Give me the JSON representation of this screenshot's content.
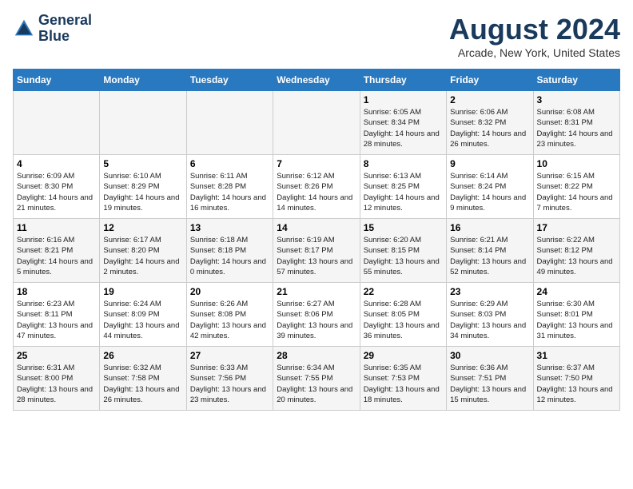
{
  "logo": {
    "line1": "General",
    "line2": "Blue"
  },
  "title": "August 2024",
  "subtitle": "Arcade, New York, United States",
  "days_of_week": [
    "Sunday",
    "Monday",
    "Tuesday",
    "Wednesday",
    "Thursday",
    "Friday",
    "Saturday"
  ],
  "weeks": [
    [
      {
        "day": "",
        "info": ""
      },
      {
        "day": "",
        "info": ""
      },
      {
        "day": "",
        "info": ""
      },
      {
        "day": "",
        "info": ""
      },
      {
        "day": "1",
        "info": "Sunrise: 6:05 AM\nSunset: 8:34 PM\nDaylight: 14 hours\nand 28 minutes."
      },
      {
        "day": "2",
        "info": "Sunrise: 6:06 AM\nSunset: 8:32 PM\nDaylight: 14 hours\nand 26 minutes."
      },
      {
        "day": "3",
        "info": "Sunrise: 6:08 AM\nSunset: 8:31 PM\nDaylight: 14 hours\nand 23 minutes."
      }
    ],
    [
      {
        "day": "4",
        "info": "Sunrise: 6:09 AM\nSunset: 8:30 PM\nDaylight: 14 hours\nand 21 minutes."
      },
      {
        "day": "5",
        "info": "Sunrise: 6:10 AM\nSunset: 8:29 PM\nDaylight: 14 hours\nand 19 minutes."
      },
      {
        "day": "6",
        "info": "Sunrise: 6:11 AM\nSunset: 8:28 PM\nDaylight: 14 hours\nand 16 minutes."
      },
      {
        "day": "7",
        "info": "Sunrise: 6:12 AM\nSunset: 8:26 PM\nDaylight: 14 hours\nand 14 minutes."
      },
      {
        "day": "8",
        "info": "Sunrise: 6:13 AM\nSunset: 8:25 PM\nDaylight: 14 hours\nand 12 minutes."
      },
      {
        "day": "9",
        "info": "Sunrise: 6:14 AM\nSunset: 8:24 PM\nDaylight: 14 hours\nand 9 minutes."
      },
      {
        "day": "10",
        "info": "Sunrise: 6:15 AM\nSunset: 8:22 PM\nDaylight: 14 hours\nand 7 minutes."
      }
    ],
    [
      {
        "day": "11",
        "info": "Sunrise: 6:16 AM\nSunset: 8:21 PM\nDaylight: 14 hours\nand 5 minutes."
      },
      {
        "day": "12",
        "info": "Sunrise: 6:17 AM\nSunset: 8:20 PM\nDaylight: 14 hours\nand 2 minutes."
      },
      {
        "day": "13",
        "info": "Sunrise: 6:18 AM\nSunset: 8:18 PM\nDaylight: 14 hours\nand 0 minutes."
      },
      {
        "day": "14",
        "info": "Sunrise: 6:19 AM\nSunset: 8:17 PM\nDaylight: 13 hours\nand 57 minutes."
      },
      {
        "day": "15",
        "info": "Sunrise: 6:20 AM\nSunset: 8:15 PM\nDaylight: 13 hours\nand 55 minutes."
      },
      {
        "day": "16",
        "info": "Sunrise: 6:21 AM\nSunset: 8:14 PM\nDaylight: 13 hours\nand 52 minutes."
      },
      {
        "day": "17",
        "info": "Sunrise: 6:22 AM\nSunset: 8:12 PM\nDaylight: 13 hours\nand 49 minutes."
      }
    ],
    [
      {
        "day": "18",
        "info": "Sunrise: 6:23 AM\nSunset: 8:11 PM\nDaylight: 13 hours\nand 47 minutes."
      },
      {
        "day": "19",
        "info": "Sunrise: 6:24 AM\nSunset: 8:09 PM\nDaylight: 13 hours\nand 44 minutes."
      },
      {
        "day": "20",
        "info": "Sunrise: 6:26 AM\nSunset: 8:08 PM\nDaylight: 13 hours\nand 42 minutes."
      },
      {
        "day": "21",
        "info": "Sunrise: 6:27 AM\nSunset: 8:06 PM\nDaylight: 13 hours\nand 39 minutes."
      },
      {
        "day": "22",
        "info": "Sunrise: 6:28 AM\nSunset: 8:05 PM\nDaylight: 13 hours\nand 36 minutes."
      },
      {
        "day": "23",
        "info": "Sunrise: 6:29 AM\nSunset: 8:03 PM\nDaylight: 13 hours\nand 34 minutes."
      },
      {
        "day": "24",
        "info": "Sunrise: 6:30 AM\nSunset: 8:01 PM\nDaylight: 13 hours\nand 31 minutes."
      }
    ],
    [
      {
        "day": "25",
        "info": "Sunrise: 6:31 AM\nSunset: 8:00 PM\nDaylight: 13 hours\nand 28 minutes."
      },
      {
        "day": "26",
        "info": "Sunrise: 6:32 AM\nSunset: 7:58 PM\nDaylight: 13 hours\nand 26 minutes."
      },
      {
        "day": "27",
        "info": "Sunrise: 6:33 AM\nSunset: 7:56 PM\nDaylight: 13 hours\nand 23 minutes."
      },
      {
        "day": "28",
        "info": "Sunrise: 6:34 AM\nSunset: 7:55 PM\nDaylight: 13 hours\nand 20 minutes."
      },
      {
        "day": "29",
        "info": "Sunrise: 6:35 AM\nSunset: 7:53 PM\nDaylight: 13 hours\nand 18 minutes."
      },
      {
        "day": "30",
        "info": "Sunrise: 6:36 AM\nSunset: 7:51 PM\nDaylight: 13 hours\nand 15 minutes."
      },
      {
        "day": "31",
        "info": "Sunrise: 6:37 AM\nSunset: 7:50 PM\nDaylight: 13 hours\nand 12 minutes."
      }
    ]
  ]
}
